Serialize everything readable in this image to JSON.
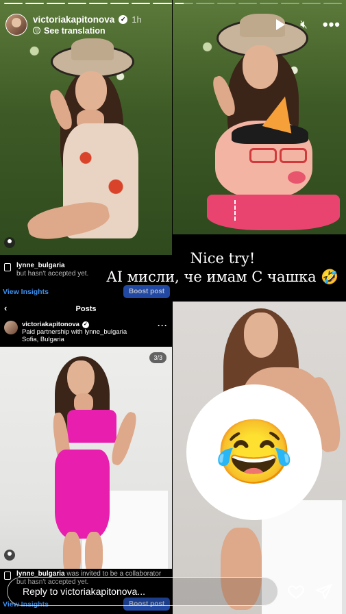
{
  "story": {
    "progress_segments": [
      1,
      1,
      1,
      1,
      1,
      1,
      1,
      1,
      0.5,
      0,
      0,
      0,
      0,
      0,
      0,
      0
    ]
  },
  "header": {
    "username": "victoriakapitonova",
    "time": "1h",
    "see_translation": "See translation",
    "icons": [
      "play-icon",
      "mute-icon",
      "more-icon"
    ]
  },
  "top_left_post": {
    "overlay_user": "victoriakapitonova",
    "overlay_line2": "Paid partnership with lynne_bulgaria",
    "overlay_line3": "Sofia, Bulgaria",
    "collab_user": "lynne_bulgaria",
    "collab_rest": "but hasn't accepted yet.",
    "view_insights": "View Insights",
    "boost_post": "Boost post"
  },
  "caption": {
    "line1": "Nice try!",
    "line2": "AI мисли, че имам С чашка 🤣"
  },
  "bottom_left_post": {
    "tab_title": "Posts",
    "username": "victoriakapitonova",
    "partnership": "Paid partnership with lynne_bulgaria",
    "location": "Sofia, Bulgaria",
    "counter": "3/3",
    "collab_user": "lynne_bulgaria",
    "collab_rest": "was invited to be a collaborator",
    "collab_rest2": "but hasn't accepted yet.",
    "view_insights": "View Insights",
    "boost_post": "Boost post"
  },
  "sticker": {
    "emoji": "😂"
  },
  "reply": {
    "placeholder": "Reply to victoriakapitonova..."
  },
  "colors": {
    "accent_blue": "#3c8ff0",
    "shorts_pink": "#e9446f",
    "dress_magenta": "#e81fae"
  }
}
